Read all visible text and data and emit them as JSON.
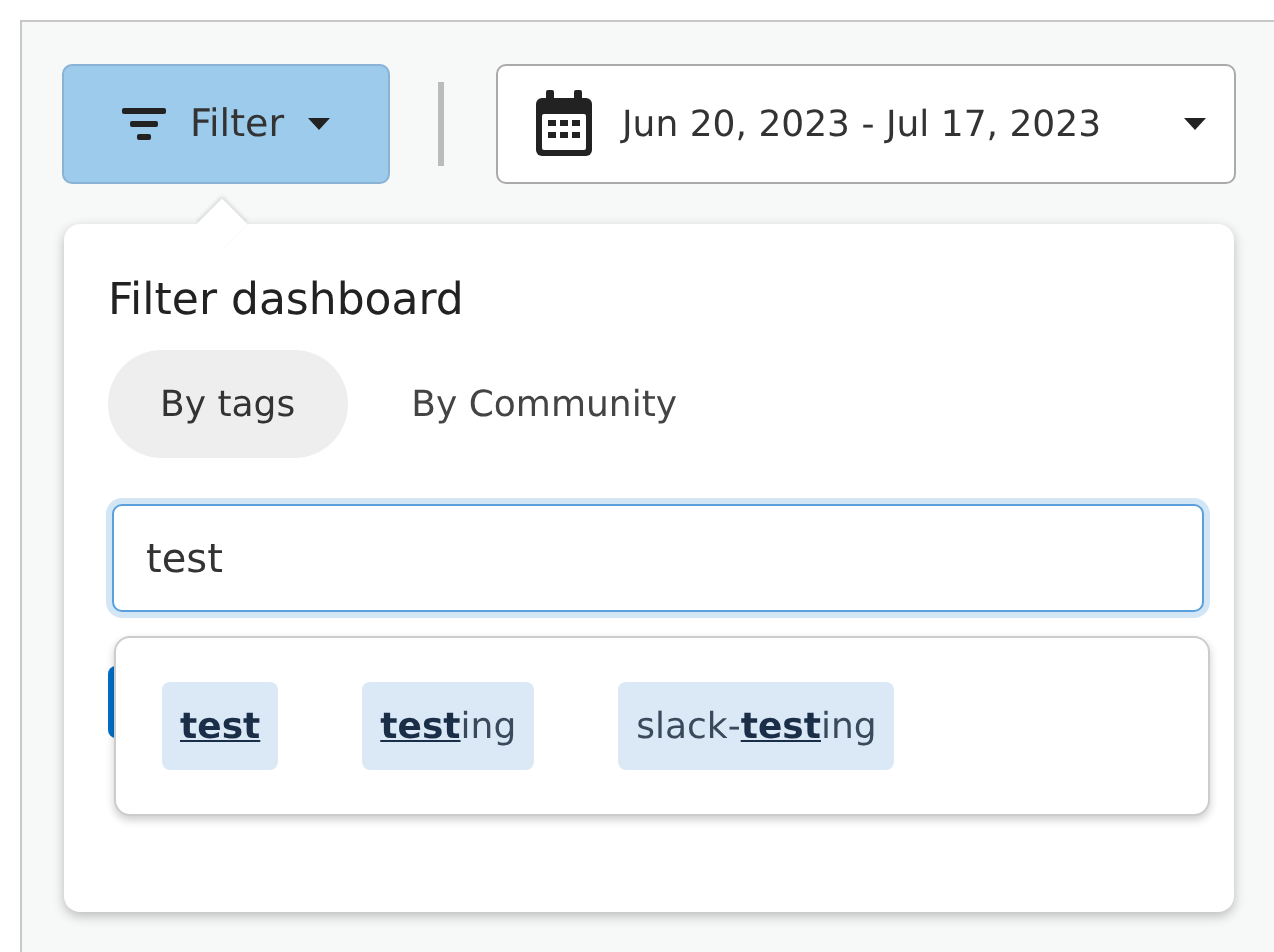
{
  "toolbar": {
    "filter_button": {
      "label": "Filter",
      "active": true
    },
    "date_range": {
      "label": "Jun 20, 2023 - Jul 17, 2023"
    }
  },
  "filter_popover": {
    "title": "Filter dashboard",
    "tabs": [
      {
        "label": "By tags",
        "selected": true
      },
      {
        "label": "By Community",
        "selected": false
      }
    ],
    "search": {
      "value": "test"
    },
    "suggestions": [
      {
        "match": "test"
      },
      {
        "match": "test",
        "suffix": "ing"
      },
      {
        "prefix": "slack-",
        "match": "test",
        "suffix": "ing"
      }
    ]
  }
}
